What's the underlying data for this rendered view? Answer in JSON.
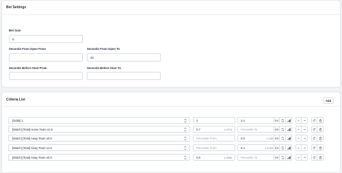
{
  "bet_settings": {
    "title": "Bet Settings",
    "bet_sum": {
      "label": "Bet Sum",
      "value": "5"
    },
    "from_open_from": {
      "label": "Seconds From Open From",
      "value": ""
    },
    "from_open_to": {
      "label": "Seconds From Open To",
      "value": "30"
    },
    "before_start_from": {
      "label": "Seconds Before Start From",
      "value": ""
    },
    "before_start_to": {
      "label": "Seconds Before Start To",
      "value": ""
    }
  },
  "criteria": {
    "title": "Criteria List",
    "add_label": "Add",
    "rows": [
      {
        "selection": "[Odds] 1",
        "from": "2",
        "from_hint": "",
        "to": "2.4",
        "to_hint": ""
      },
      {
        "selection": "[Match] [Total] Home Team o2.5",
        "from": "0.7",
        "from_hint": "1.3774",
        "to": "",
        "to_hint": ""
      },
      {
        "selection": "[Match] [Total] Away Team o0.5",
        "from": "",
        "from_hint": "",
        "to": "0.5",
        "to_hint": "1.155"
      },
      {
        "selection": "[Match] [Total] Away Team o1.5",
        "from": "",
        "from_hint": "",
        "to": "0.4",
        "to_hint": "1.1234"
      },
      {
        "selection": "[Match] [Total] Away Team o0.5",
        "from": "0.6",
        "from_hint": "1.2555",
        "to": "",
        "to_hint": ""
      }
    ],
    "placeholders": {
      "from": "Percentile From",
      "to": "Percentile To"
    },
    "icons": [
      "link-icon",
      "refresh-icon",
      "bars-icon",
      "chevron-up-icon",
      "minus-icon",
      "swap-icon",
      "trash-icon"
    ]
  }
}
